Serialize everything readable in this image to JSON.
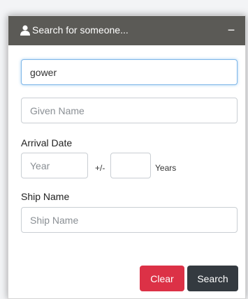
{
  "header": {
    "title": "Search for someone...",
    "collapse_label": "−"
  },
  "form": {
    "surname": {
      "value": "gower"
    },
    "given_name": {
      "placeholder": "Given Name"
    },
    "arrival_date": {
      "label": "Arrival Date",
      "year_placeholder": "Year",
      "plus_minus": "+/-",
      "years_suffix": "Years"
    },
    "ship_name": {
      "label": "Ship Name",
      "placeholder": "Ship Name"
    }
  },
  "buttons": {
    "clear_label": "Clear",
    "search_label": "Search"
  },
  "colors": {
    "header_bg": "#5b5a56",
    "clear_bg": "#dc3146",
    "search_bg": "#343a40",
    "focus_border": "#7eb6e8"
  }
}
